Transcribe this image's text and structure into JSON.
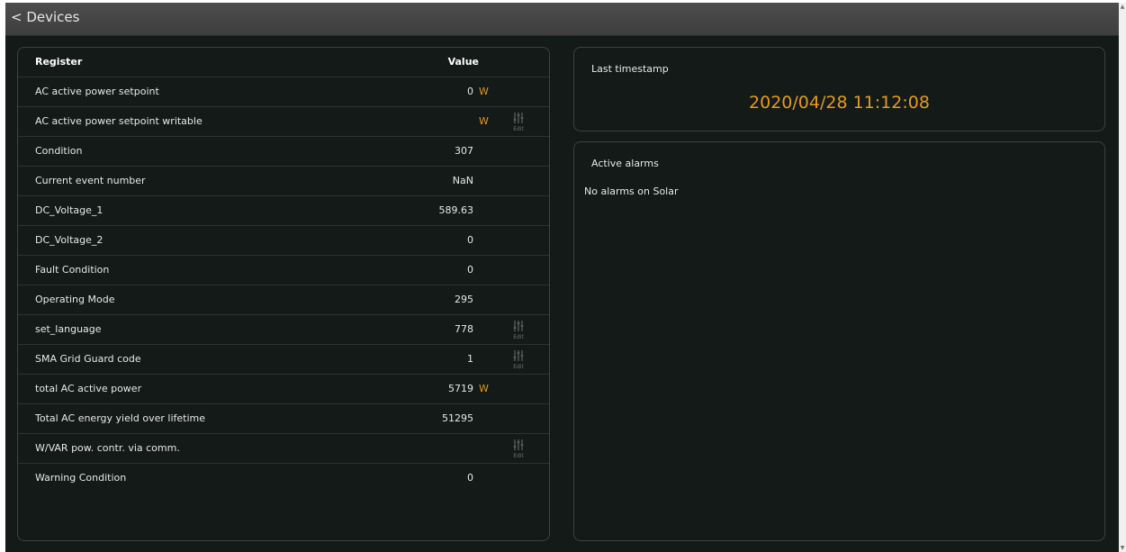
{
  "nav": {
    "back_label": "< Devices"
  },
  "table": {
    "header": {
      "register": "Register",
      "value": "Value"
    },
    "edit_label": "Edit",
    "rows": [
      {
        "name": "AC active power setpoint",
        "value": "0",
        "unit": "W",
        "editable": false
      },
      {
        "name": "AC active power setpoint writable",
        "value": "",
        "unit": "W",
        "editable": true
      },
      {
        "name": "Condition",
        "value": "307",
        "unit": "",
        "editable": false
      },
      {
        "name": "Current event number",
        "value": "NaN",
        "unit": "",
        "editable": false
      },
      {
        "name": "DC_Voltage_1",
        "value": "589.63",
        "unit": "",
        "editable": false
      },
      {
        "name": "DC_Voltage_2",
        "value": "0",
        "unit": "",
        "editable": false
      },
      {
        "name": "Fault Condition",
        "value": "0",
        "unit": "",
        "editable": false
      },
      {
        "name": "Operating Mode",
        "value": "295",
        "unit": "",
        "editable": false
      },
      {
        "name": "set_language",
        "value": "778",
        "unit": "",
        "editable": true
      },
      {
        "name": "SMA Grid Guard code",
        "value": "1",
        "unit": "",
        "editable": true
      },
      {
        "name": "total AC active power",
        "value": "5719",
        "unit": "W",
        "editable": false
      },
      {
        "name": "Total AC energy yield over lifetime",
        "value": "51295",
        "unit": "",
        "editable": false
      },
      {
        "name": "W/VAR pow. contr. via comm.",
        "value": "",
        "unit": "",
        "editable": true
      },
      {
        "name": "Warning Condition",
        "value": "0",
        "unit": "",
        "editable": false
      }
    ]
  },
  "timestamp": {
    "title": "Last timestamp",
    "value": "2020/04/28 11:12:08"
  },
  "alarms": {
    "title": "Active alarms",
    "message": "No alarms on Solar"
  },
  "colors": {
    "accent": "#e59b1b",
    "background": "#131a18",
    "topbar": "#454545",
    "border": "#3a4440"
  },
  "icons": {
    "edit": "sliders-icon",
    "scroll_up": "arrow-up-icon",
    "scroll_down": "arrow-down-icon"
  }
}
